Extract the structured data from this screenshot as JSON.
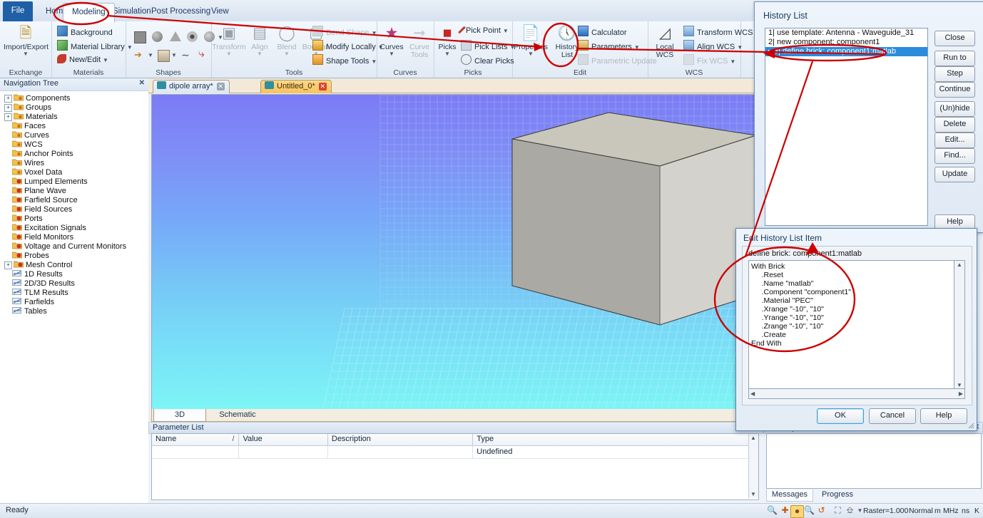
{
  "ribbon": {
    "tabs": [
      {
        "label": "File",
        "active": false
      },
      {
        "label": "Home",
        "active": false
      },
      {
        "label": "Modeling",
        "active": true
      },
      {
        "label": "Simulation",
        "active": false
      },
      {
        "label": "Post Processing",
        "active": false
      },
      {
        "label": "View",
        "active": false
      }
    ],
    "groups": [
      {
        "title": "Exchange",
        "big": [
          {
            "label_1": "Import/Export",
            "icon": "import-export-icon"
          }
        ]
      },
      {
        "title": "Materials",
        "items": [
          {
            "label": "Background",
            "icon": "background-icon"
          },
          {
            "label": "Material Library",
            "icon": "material-library-icon",
            "dropdown": true
          },
          {
            "label": "New/Edit",
            "icon": "new-edit-icon",
            "dropdown": true
          }
        ]
      },
      {
        "title": "Shapes",
        "items": []
      },
      {
        "title": "Tools",
        "big": [
          {
            "label": "Transform",
            "icon": "transform-icon"
          },
          {
            "label": "Align",
            "icon": "align-icon"
          },
          {
            "label": "Blend",
            "icon": "blend-icon"
          },
          {
            "label": "Boolean",
            "icon": "boolean-icon"
          }
        ],
        "items": [
          {
            "label": "Bend Shape",
            "icon": "bend-shape-icon",
            "dropdown": true,
            "dim": true
          },
          {
            "label": "Modify Locally",
            "icon": "modify-locally-icon",
            "dropdown": true
          },
          {
            "label": "Shape Tools",
            "icon": "shape-tools-icon",
            "dropdown": true
          }
        ]
      },
      {
        "title": "Curves",
        "big": [
          {
            "label": "Curves",
            "icon": "curves-icon"
          },
          {
            "label_1": "Curve",
            "label_2": "Tools",
            "icon": "curve-tools-icon",
            "dim": true
          }
        ]
      },
      {
        "title": "Picks",
        "big": [
          {
            "label": "Picks",
            "icon": "picks-icon"
          }
        ],
        "items": [
          {
            "label": "Pick Point",
            "icon": "pick-point-icon",
            "dropdown": true
          },
          {
            "label": "Pick Lists",
            "icon": "pick-lists-icon",
            "dropdown": true
          },
          {
            "label": "Clear Picks",
            "icon": "clear-picks-icon"
          }
        ]
      },
      {
        "title": "Edit",
        "big": [
          {
            "label": "Properties",
            "icon": "properties-icon"
          },
          {
            "label_1": "History",
            "label_2": "List",
            "icon": "history-list-icon"
          }
        ],
        "items": [
          {
            "label": "Calculator",
            "icon": "calculator-icon"
          },
          {
            "label": "Parameters",
            "icon": "parameters-icon",
            "dropdown": true
          },
          {
            "label": "Parametric Update",
            "icon": "parametric-update-icon",
            "dim": true
          }
        ]
      },
      {
        "title": "WCS",
        "big": [
          {
            "label_1": "Local",
            "label_2": "WCS",
            "icon": "local-wcs-icon",
            "dropdown": true
          }
        ],
        "items": [
          {
            "label": "Transform WCS",
            "icon": "transform-wcs-icon"
          },
          {
            "label": "Align WCS",
            "icon": "align-wcs-icon",
            "dropdown": true
          },
          {
            "label": "Fix WCS",
            "icon": "fix-wcs-icon",
            "dropdown": true,
            "dim": true
          }
        ]
      }
    ]
  },
  "navtree": {
    "header": "Navigation Tree",
    "close": "✕",
    "items": [
      {
        "label": "Components",
        "expandable": true,
        "icon": "folder-yellow"
      },
      {
        "label": "Groups",
        "expandable": true,
        "icon": "folder-yellow"
      },
      {
        "label": "Materials",
        "expandable": true,
        "icon": "folder-yellow"
      },
      {
        "label": "Faces",
        "expandable": false,
        "icon": "folder-yellow"
      },
      {
        "label": "Curves",
        "expandable": false,
        "icon": "folder-yellow"
      },
      {
        "label": "WCS",
        "expandable": false,
        "icon": "folder-yellow"
      },
      {
        "label": "Anchor Points",
        "expandable": false,
        "icon": "folder-yellow"
      },
      {
        "label": "Wires",
        "expandable": false,
        "icon": "folder-yellow"
      },
      {
        "label": "Voxel Data",
        "expandable": false,
        "icon": "folder-yellow"
      },
      {
        "label": "Lumped Elements",
        "expandable": false,
        "icon": "folder-red"
      },
      {
        "label": "Plane Wave",
        "expandable": false,
        "icon": "folder-red"
      },
      {
        "label": "Farfield Source",
        "expandable": false,
        "icon": "folder-red"
      },
      {
        "label": "Field Sources",
        "expandable": false,
        "icon": "folder-red"
      },
      {
        "label": "Ports",
        "expandable": false,
        "icon": "folder-red"
      },
      {
        "label": "Excitation Signals",
        "expandable": false,
        "icon": "folder-red"
      },
      {
        "label": "Field Monitors",
        "expandable": false,
        "icon": "folder-red"
      },
      {
        "label": "Voltage and Current Monitors",
        "expandable": false,
        "icon": "folder-red"
      },
      {
        "label": "Probes",
        "expandable": false,
        "icon": "folder-red"
      },
      {
        "label": "Mesh Control",
        "expandable": true,
        "icon": "folder-red"
      },
      {
        "label": "1D Results",
        "expandable": false,
        "icon": "results-icon"
      },
      {
        "label": "2D/3D Results",
        "expandable": false,
        "icon": "results-icon"
      },
      {
        "label": "TLM Results",
        "expandable": false,
        "icon": "results-icon"
      },
      {
        "label": "Farfields",
        "expandable": false,
        "icon": "results-icon"
      },
      {
        "label": "Tables",
        "expandable": false,
        "icon": "results-icon"
      }
    ]
  },
  "doctabs": [
    {
      "label": "dipole array*",
      "active": false,
      "close": "✕"
    },
    {
      "label": "Untitled_0*",
      "active": true,
      "close": "✕"
    }
  ],
  "viewport": {
    "bottom_tabs": [
      {
        "label": "3D",
        "selected": true
      },
      {
        "label": "Schematic",
        "selected": false
      }
    ],
    "bg_top": "#7b7bf5",
    "bg_bottom": "#7df5f5",
    "brick_top_color": "#c9c7bc",
    "brick_left_color": "#a9a9a4",
    "brick_right_color": "#d5d3cd"
  },
  "parameter_list": {
    "header": "Parameter List",
    "close": "✕",
    "columns": [
      "Name",
      "Value",
      "Description",
      "Type"
    ],
    "sort_mark": "/",
    "rows": [
      {
        "Name": "",
        "Value": "",
        "Description": "",
        "Type": "Undefined"
      }
    ]
  },
  "messages": {
    "header": "Messages",
    "close": "✕",
    "body": "",
    "tabs": [
      {
        "label": "Messages",
        "selected": true
      },
      {
        "label": "Progress",
        "selected": false
      }
    ]
  },
  "statusbar": {
    "ready": "Ready",
    "icons": [
      "zoom-region-icon",
      "pan-icon",
      "rotate-view-icon",
      "zoom-icon",
      "rotate-plane-icon",
      "fit-view-icon",
      "view-cube-icon",
      "view-cube-dropdown-icon"
    ],
    "raster": "Raster=1.000",
    "mode": "Normal",
    "unit_length": "m",
    "unit_freq": "MHz",
    "unit_time": "ns",
    "unit_temp": "K"
  },
  "history_list": {
    "title": "History List",
    "items": [
      {
        "index": "1|",
        "text": " use template: Antenna - Waveguide_31",
        "selected": false
      },
      {
        "index": "2|",
        "text": " new component: component1",
        "selected": false
      },
      {
        "index": "3|",
        "text": " define brick: component1:matlab",
        "selected": true
      }
    ],
    "buttons": [
      {
        "label": "Close"
      },
      {
        "label": "Run to"
      },
      {
        "label": "Step"
      },
      {
        "label": "Continue"
      },
      {
        "label": "(Un)hide"
      },
      {
        "label": "Delete"
      },
      {
        "label": "Edit..."
      },
      {
        "label": "Find..."
      },
      {
        "label": "Update"
      },
      {
        "label": "Help"
      }
    ]
  },
  "edit_history_dialog": {
    "title": "Edit History List Item",
    "caption": "define brick: component1:matlab",
    "code_lines": [
      "With Brick",
      "     .Reset",
      "     .Name \"matlab\"",
      "     .Component \"component1\"",
      "     .Material \"PEC\"",
      "     .Xrange \"-10\", \"10\"",
      "     .Yrange \"-10\", \"10\"",
      "     .Zrange \"-10\", \"10\"",
      "     .Create",
      "End With"
    ],
    "buttons": [
      {
        "label": "OK",
        "default": true
      },
      {
        "label": "Cancel",
        "default": false
      },
      {
        "label": "Help",
        "default": false
      }
    ]
  },
  "annotations": {
    "color": "#cc0000",
    "ellipse_modeling_tab": "Modeling tab highlighted",
    "ellipse_history_list_button": "History List button highlighted",
    "ellipse_history_item": "Selected history entry highlighted",
    "ellipse_code_block": "Brick VBA code highlighted"
  }
}
